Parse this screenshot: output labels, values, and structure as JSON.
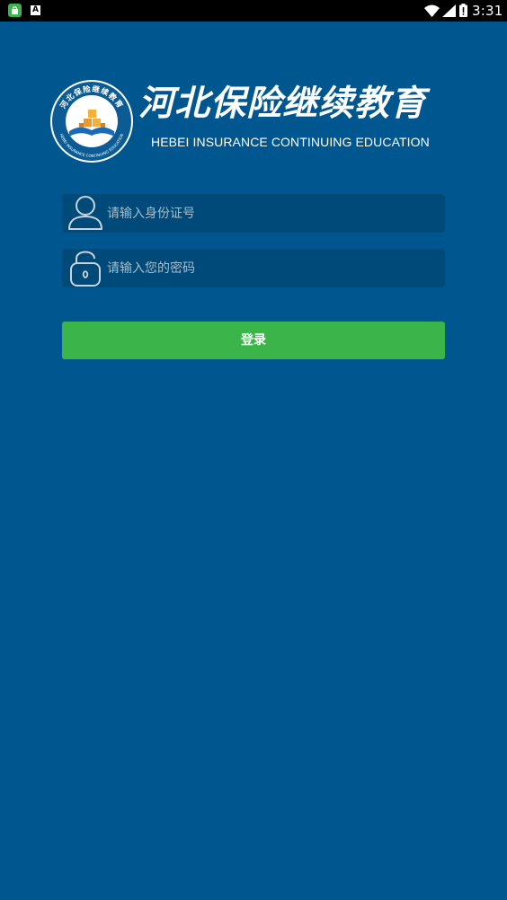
{
  "status_bar": {
    "time": "3:31",
    "icons": [
      "app-notification-icon",
      "a-notification-icon",
      "wifi-icon",
      "signal-icon",
      "battery-icon"
    ]
  },
  "header": {
    "title": "河北保险继续教育",
    "subtitle": "HEBEI INSURANCE CONTINUING EDUCATION",
    "emblem_title": "河北保险继续教育",
    "emblem_subtitle": "HEBEI INSURANCE CONTINUING EDUCATION"
  },
  "form": {
    "id_placeholder": "请输入身份证号",
    "id_icon": "user-icon",
    "password_placeholder": "请输入您的密码",
    "password_icon": "lock-icon",
    "login_label": "登录"
  },
  "colors": {
    "background": "#00578f",
    "field_background": "#004a79",
    "login_button": "#3bb54a",
    "status_bar": "#000000"
  }
}
